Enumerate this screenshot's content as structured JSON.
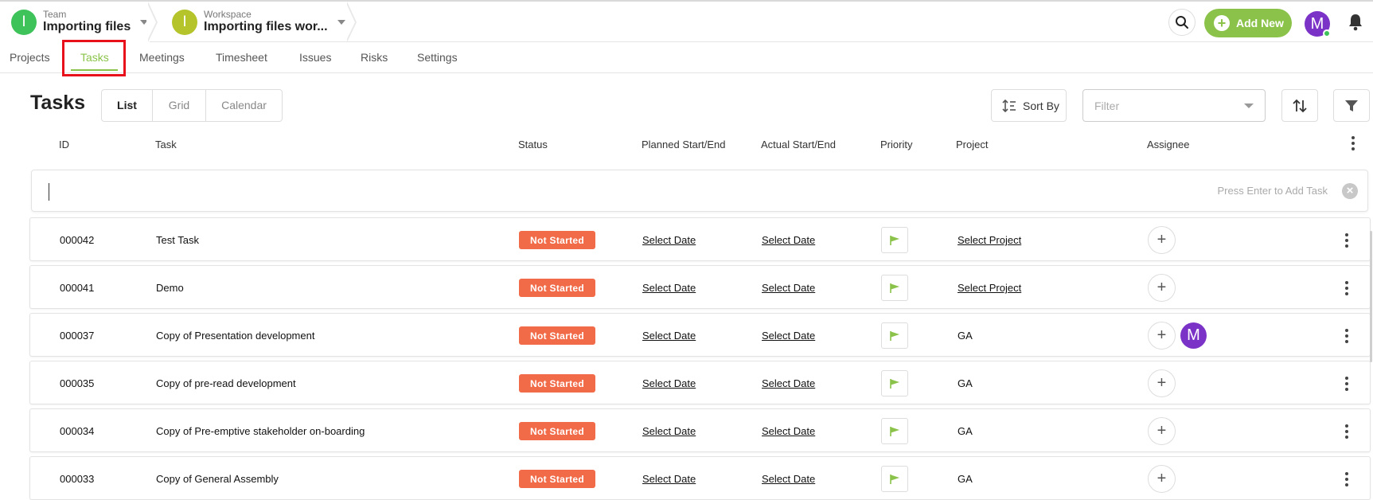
{
  "topbar": {
    "team": {
      "label": "Team",
      "name": "Importing files",
      "avatar_letter": "I",
      "avatar_color": "#3ec25a"
    },
    "workspace": {
      "label": "Workspace",
      "name": "Importing files wor...",
      "avatar_letter": "I",
      "avatar_color": "#b4c42a"
    },
    "search_icon": "search-icon",
    "add_new_label": "Add New",
    "user_avatar_letter": "M",
    "bell_icon": "bell-icon"
  },
  "nav": {
    "tabs": [
      {
        "label": "Projects",
        "active": false
      },
      {
        "label": "Tasks",
        "active": true
      },
      {
        "label": "Meetings",
        "active": false
      },
      {
        "label": "Timesheet",
        "active": false
      },
      {
        "label": "Issues",
        "active": false
      },
      {
        "label": "Risks",
        "active": false
      },
      {
        "label": "Settings",
        "active": false
      }
    ]
  },
  "header": {
    "title": "Tasks",
    "views": [
      {
        "label": "List",
        "active": true
      },
      {
        "label": "Grid",
        "active": false
      },
      {
        "label": "Calendar",
        "active": false
      }
    ],
    "sort_label": "Sort By",
    "filter_placeholder": "Filter"
  },
  "columns": [
    "ID",
    "Task",
    "Status",
    "Planned Start/End",
    "Actual Start/End",
    "Priority",
    "Project",
    "Assignee"
  ],
  "quick_add": {
    "value": "",
    "hint": "Press Enter to Add Task"
  },
  "tasks": [
    {
      "id": "000042",
      "name": "Test Task",
      "status": "Not Started",
      "planned": "Select Date",
      "actual": "Select Date",
      "project": "Select Project",
      "project_is_link": true,
      "assignee": ""
    },
    {
      "id": "000041",
      "name": "Demo",
      "status": "Not Started",
      "planned": "Select Date",
      "actual": "Select Date",
      "project": "Select Project",
      "project_is_link": true,
      "assignee": ""
    },
    {
      "id": "000037",
      "name": "Copy of Presentation development",
      "status": "Not Started",
      "planned": "Select Date",
      "actual": "Select Date",
      "project": "GA",
      "project_is_link": false,
      "assignee": "M"
    },
    {
      "id": "000035",
      "name": "Copy of pre-read development",
      "status": "Not Started",
      "planned": "Select Date",
      "actual": "Select Date",
      "project": "GA",
      "project_is_link": false,
      "assignee": ""
    },
    {
      "id": "000034",
      "name": "Copy of Pre-emptive stakeholder on-boarding",
      "status": "Not Started",
      "planned": "Select Date",
      "actual": "Select Date",
      "project": "GA",
      "project_is_link": false,
      "assignee": ""
    },
    {
      "id": "000033",
      "name": "Copy of General Assembly",
      "status": "Not Started",
      "planned": "Select Date",
      "actual": "Select Date",
      "project": "GA",
      "project_is_link": false,
      "assignee": ""
    }
  ],
  "colors": {
    "accent": "#8bc34a",
    "status_not_started": "#f26b49",
    "avatar_purple": "#7b33c7",
    "highlight": "#e8101a"
  }
}
